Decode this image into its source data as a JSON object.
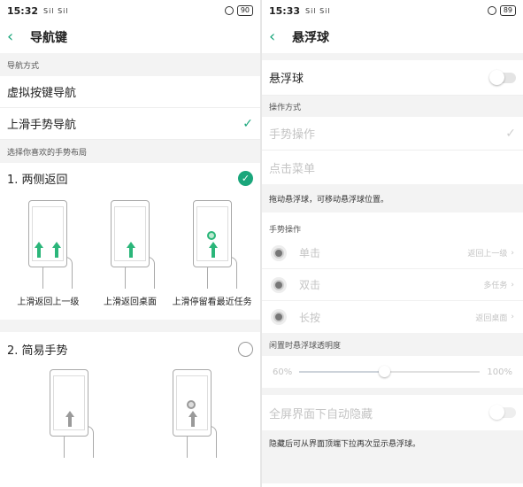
{
  "left": {
    "status": {
      "time": "15:32",
      "signal": "Sil Sil",
      "battery": "90"
    },
    "title": "导航键",
    "nav_mode_label": "导航方式",
    "options": [
      {
        "label": "虚拟按键导航",
        "checked": false
      },
      {
        "label": "上滑手势导航",
        "checked": true
      }
    ],
    "layout_label": "选择你喜欢的手势布局",
    "layouts": [
      {
        "label": "1. 两侧返回",
        "selected": true,
        "captions": [
          "上滑返回上一级",
          "上滑返回桌面",
          "上滑停留看最近任务"
        ]
      },
      {
        "label": "2. 简易手势",
        "selected": false
      }
    ]
  },
  "right": {
    "status": {
      "time": "15:33",
      "signal": "Sil Sil",
      "battery": "89"
    },
    "title": "悬浮球",
    "float_ball_label": "悬浮球",
    "float_ball_on": false,
    "op_mode_label": "操作方式",
    "op_modes": [
      {
        "label": "手势操作",
        "checked": true
      },
      {
        "label": "点击菜单",
        "checked": false
      }
    ],
    "drag_note": "拖动悬浮球，可移动悬浮球位置。",
    "gesture_label": "手势操作",
    "gestures": [
      {
        "label": "单击",
        "value": "返回上一级"
      },
      {
        "label": "双击",
        "value": "多任务"
      },
      {
        "label": "长按",
        "value": "返回桌面"
      }
    ],
    "opacity_label": "闲置时悬浮球透明度",
    "opacity_min": "60%",
    "opacity_max": "100%",
    "opacity_level": 0.47,
    "auto_hide_label": "全屏界面下自动隐藏",
    "auto_hide_on": false,
    "hide_note": "隐藏后可从界面顶端下拉再次显示悬浮球。"
  },
  "colors": {
    "accent": "#1aa67b",
    "section_bg": "#f3f3f3",
    "muted_text": "#c4c4c4"
  }
}
